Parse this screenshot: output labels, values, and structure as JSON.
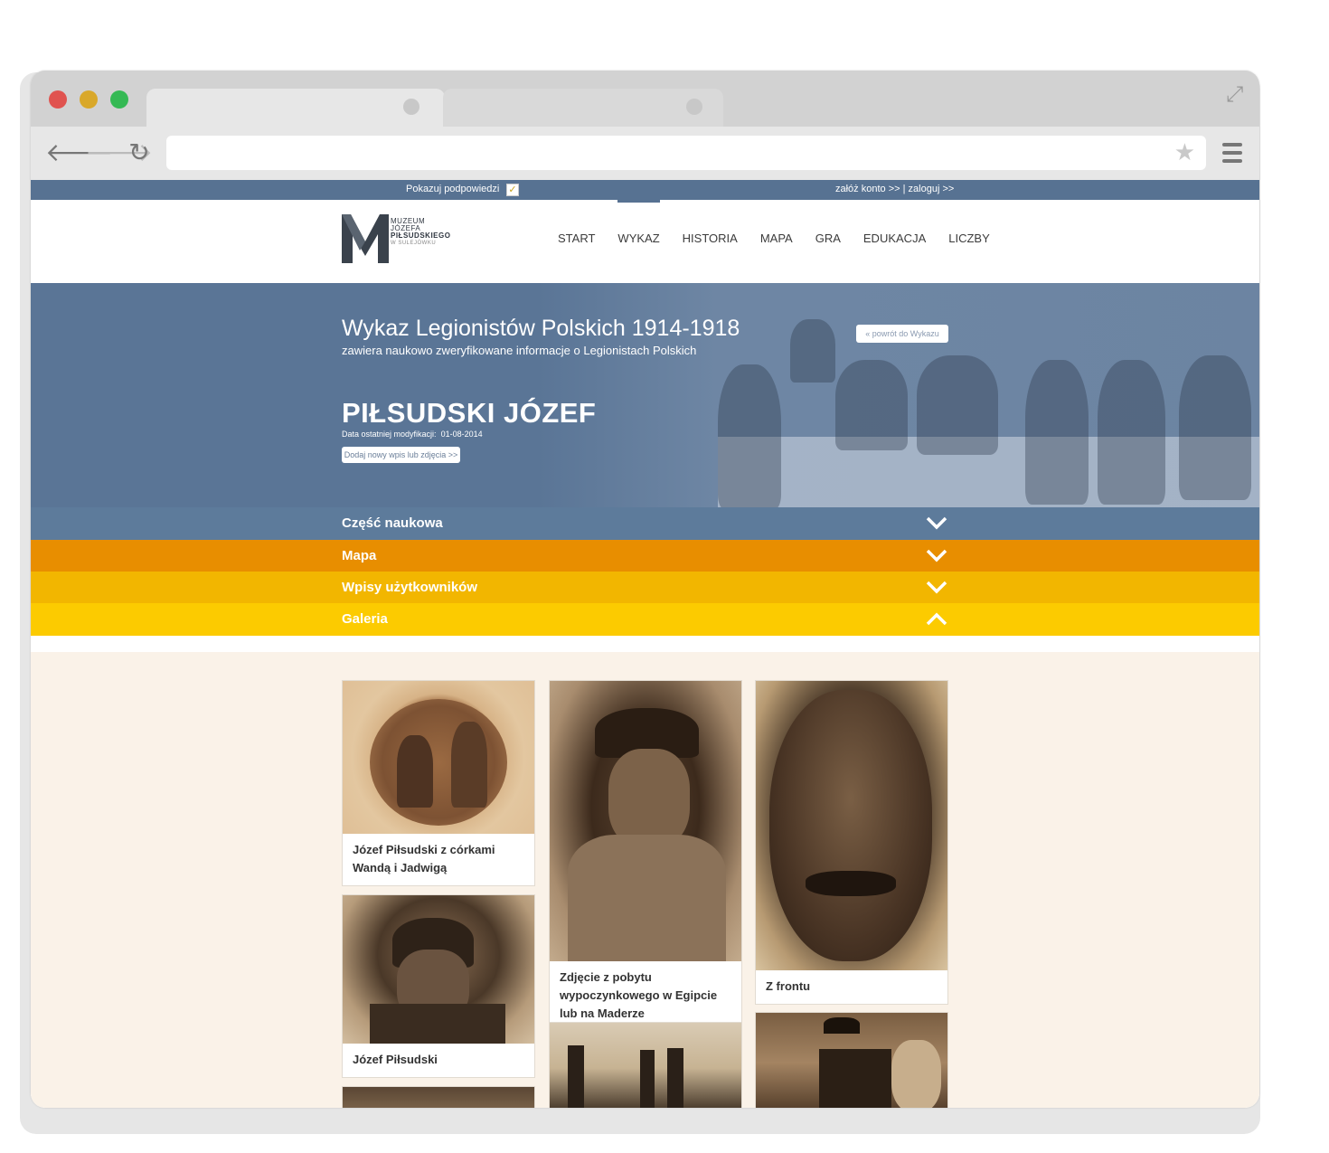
{
  "topbar": {
    "hints_label": "Pokazuj podpowiedzi",
    "hints_checked": "✓",
    "register_link": "załóż konto >>",
    "separator": "|",
    "login_link": "zaloguj >>"
  },
  "logo": {
    "line1": "MUZEUM",
    "line2": "JÓZEFA",
    "line3": "PIŁSUDSKIEGO",
    "line4": "W SULEJÓWKU"
  },
  "nav": {
    "items": [
      {
        "label": "START"
      },
      {
        "label": "WYKAZ"
      },
      {
        "label": "HISTORIA"
      },
      {
        "label": "MAPA"
      },
      {
        "label": "GRA"
      },
      {
        "label": "EDUKACJA"
      },
      {
        "label": "LICZBY"
      }
    ],
    "active": "WYKAZ"
  },
  "hero": {
    "title": "Wykaz Legionistów Polskich 1914-1918",
    "subtitle": "zawiera naukowo zweryfikowane informacje o Legionistach Polskich",
    "back_button": "« powrót do Wykazu",
    "person_name": "PIŁSUDSKI JÓZEF",
    "modified_label": "Data ostatniej modyfikacji:",
    "modified_date": "01-08-2014",
    "add_button": "Dodaj nowy wpis lub zdjęcia >>"
  },
  "accordion": [
    {
      "label": "Część naukowa",
      "state": "collapsed",
      "color": "#5d7b9b"
    },
    {
      "label": "Mapa",
      "state": "collapsed",
      "color": "#e88e00"
    },
    {
      "label": "Wpisy użytkowników",
      "state": "collapsed",
      "color": "#f2b600"
    },
    {
      "label": "Galeria",
      "state": "expanded",
      "color": "#fccb00"
    }
  ],
  "gallery": [
    {
      "caption": "Józef Piłsudski z córkami Wandą i Jadwigą"
    },
    {
      "caption": "Zdjęcie z pobytu wypoczynkowego w Egipcie lub na Maderze"
    },
    {
      "caption": "Z frontu"
    },
    {
      "caption": "Józef Piłsudski"
    }
  ],
  "colors": {
    "brand_blue": "#577292",
    "orange": "#e88e00",
    "amber": "#f2b600",
    "yellow": "#fccb00",
    "gallery_bg": "#faf2e8"
  },
  "icons": {
    "back": "arrow-left-icon",
    "forward": "arrow-right-icon",
    "reload": "reload-icon",
    "bookmark": "star-icon",
    "menu": "hamburger-icon",
    "fullscreen": "expand-icon",
    "chevron_down": "chevron-down-icon",
    "chevron_up": "chevron-up-icon"
  }
}
